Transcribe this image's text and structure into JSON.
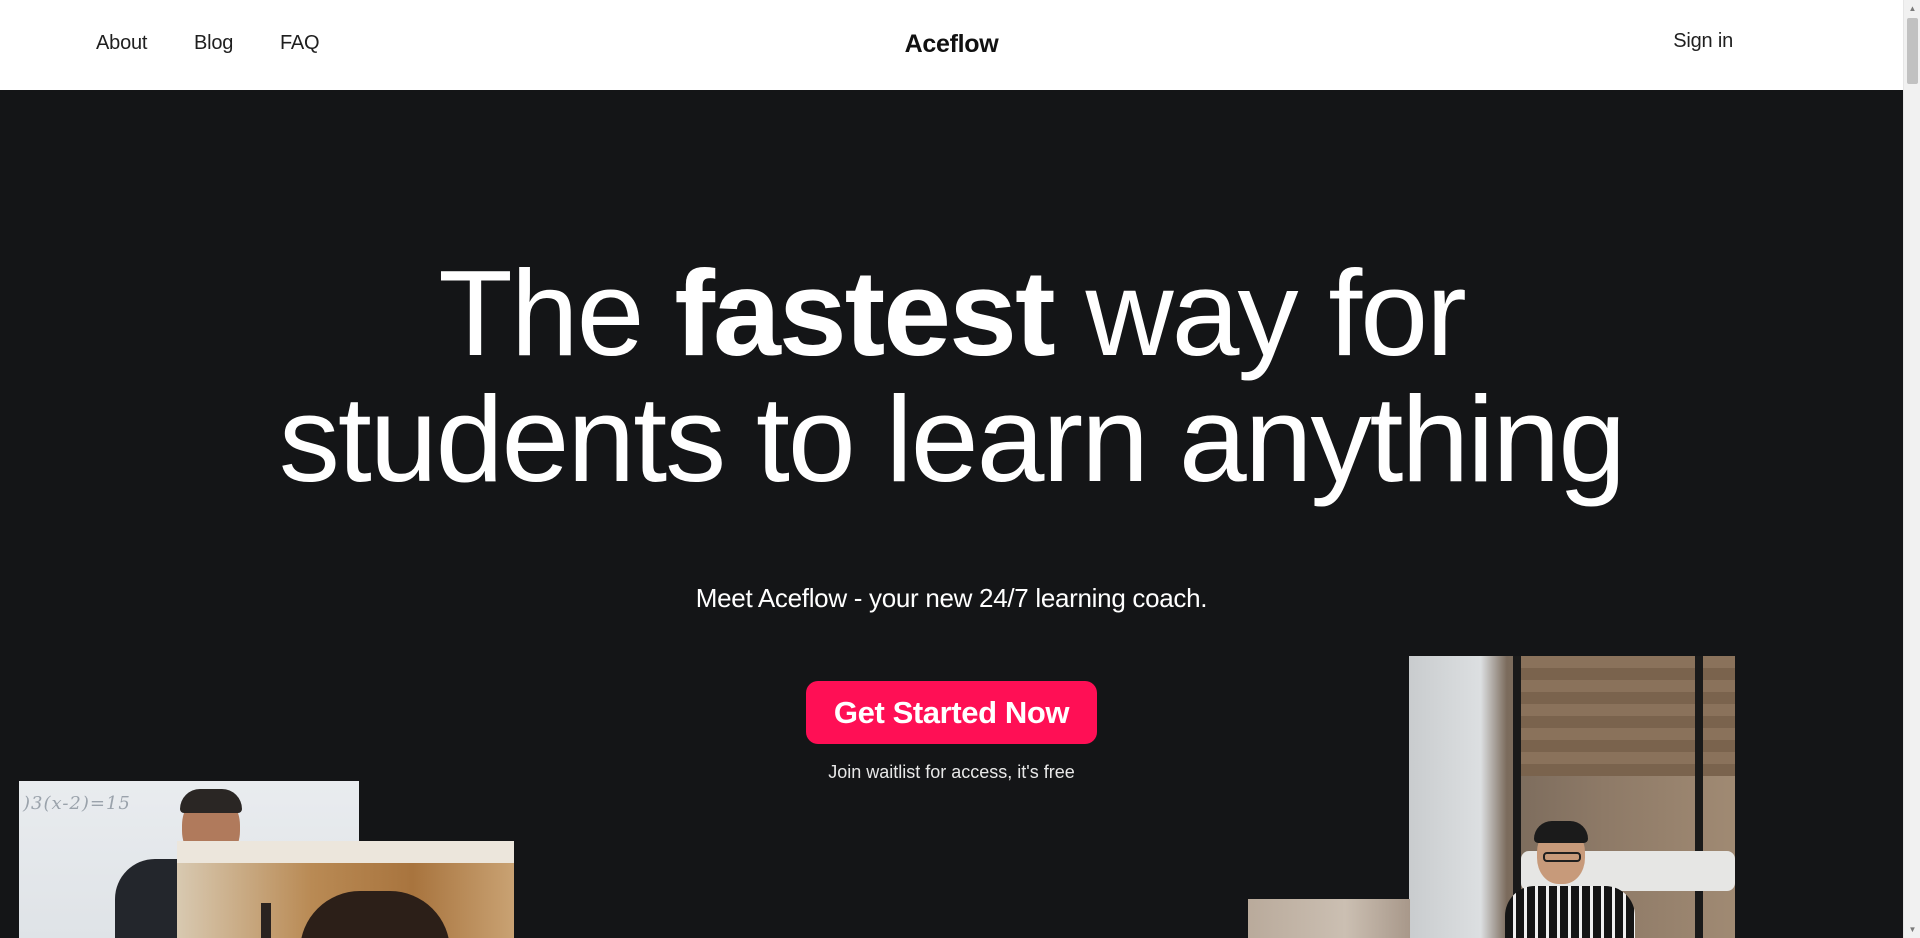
{
  "header": {
    "nav": {
      "about": "About",
      "blog": "Blog",
      "faq": "FAQ"
    },
    "brand": "Aceflow",
    "sign_in": "Sign in"
  },
  "hero": {
    "title_line1_a": "The ",
    "title_line1_bold": "fastest",
    "title_line1_b": " way for",
    "title_line2": "students to learn anything",
    "subtitle": "Meet Aceflow - your new 24/7 learning coach.",
    "cta_label": "Get Started Now",
    "note": "Join waitlist for access, it's free"
  },
  "photos": {
    "whiteboard_text": ")3(x-2)=15"
  },
  "colors": {
    "background": "#141517",
    "header_background": "#ffffff",
    "accent": "#ff0f55",
    "text_light": "#ffffff"
  }
}
